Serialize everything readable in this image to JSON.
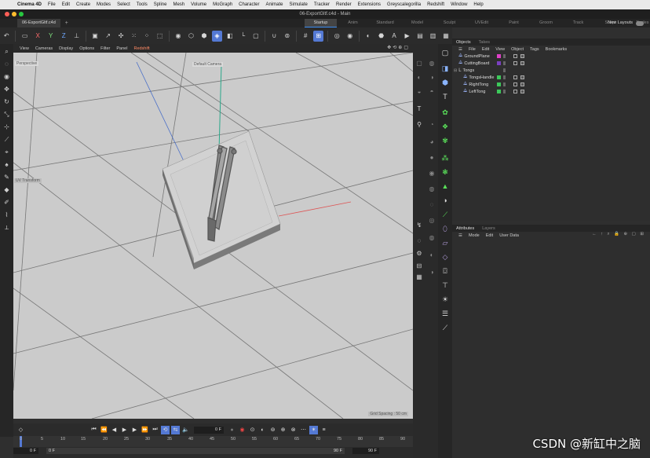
{
  "menubar": {
    "app": "Cinema 4D",
    "items": [
      "File",
      "Edit",
      "Create",
      "Modes",
      "Select",
      "Tools",
      "Spline",
      "Mesh",
      "Volume",
      "MoGraph",
      "Character",
      "Animate",
      "Simulate",
      "Tracker",
      "Render",
      "Extensions",
      "Greyscalegorilla",
      "Redshift",
      "Window",
      "Help"
    ]
  },
  "window": {
    "title": "06-ExportGltf.c4d - Main",
    "doc_tab": "06-ExportGltf.c4d",
    "layouts": [
      "Startup",
      "Anim",
      "Standard",
      "Model",
      "Sculpt",
      "UVEdit",
      "Paint",
      "Groom",
      "Track",
      "Script",
      "Nodes"
    ],
    "active_layout": "Startup",
    "new_layouts": "New Layouts"
  },
  "viewport": {
    "menu": [
      "View",
      "Cameras",
      "Display",
      "Options",
      "Filter",
      "Panel",
      "Redshift"
    ],
    "view_name": "Perspective",
    "camera_name": "Default Camera",
    "uv_label": "UV Transform",
    "grid_spacing": "Grid Spacing : 50 cm"
  },
  "timeline": {
    "current_frame": "0 F",
    "ticks": [
      "0",
      "5",
      "10",
      "15",
      "20",
      "25",
      "30",
      "35",
      "40",
      "45",
      "50",
      "55",
      "60",
      "65",
      "70",
      "75",
      "80",
      "85",
      "90"
    ],
    "start": "0 F",
    "preview_start": "0 F",
    "preview_end": "90 F",
    "end": "90 F"
  },
  "objects_panel": {
    "tabs": [
      "Objects",
      "Takes"
    ],
    "active_tab": "Objects",
    "menu": [
      "File",
      "Edit",
      "View",
      "Object",
      "Tags",
      "Bookmarks"
    ],
    "items": [
      {
        "name": "GroundPlane",
        "color": "#e040c8",
        "indent": 0
      },
      {
        "name": "CuttingBoard",
        "color": "#7a3fc0",
        "indent": 0
      },
      {
        "name": "Tongs",
        "color": "",
        "indent": 0
      },
      {
        "name": "TongsHandle",
        "color": "#3cc85a",
        "indent": 1
      },
      {
        "name": "RightTong",
        "color": "#3cc85a",
        "indent": 1
      },
      {
        "name": "LeftTong",
        "color": "#3cc85a",
        "indent": 1
      }
    ]
  },
  "attributes_panel": {
    "tabs": [
      "Attributes",
      "Layers"
    ],
    "active_tab": "Attributes",
    "menu": [
      "Mode",
      "Edit",
      "User Data"
    ]
  },
  "watermark": "CSDN @新缸中之脑"
}
